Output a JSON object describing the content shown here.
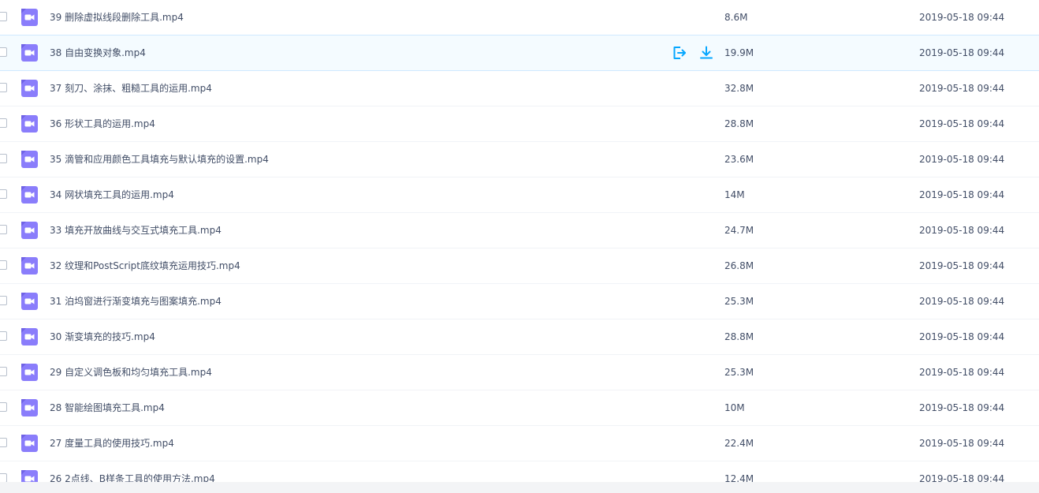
{
  "colors": {
    "video_icon": "#8a7dfb",
    "action_icon": "#06a7ff",
    "text": "#424e67",
    "hover_row": "#f4fbff"
  },
  "row_icon": "video-file-icon",
  "row_actions": [
    "share-icon",
    "download-icon"
  ],
  "files": [
    {
      "name": "39 删除虚拟线段删除工具.mp4",
      "size": "8.6M",
      "date": "2019-05-18 09:44"
    },
    {
      "name": "38 自由变换对象.mp4",
      "size": "19.9M",
      "date": "2019-05-18 09:44",
      "hover": true
    },
    {
      "name": "37 刻刀、涂抹、粗糙工具的运用.mp4",
      "size": "32.8M",
      "date": "2019-05-18 09:44"
    },
    {
      "name": "36 形状工具的运用.mp4",
      "size": "28.8M",
      "date": "2019-05-18 09:44"
    },
    {
      "name": "35 滴管和应用颜色工具填充与默认填充的设置.mp4",
      "size": "23.6M",
      "date": "2019-05-18 09:44"
    },
    {
      "name": "34 网状填充工具的运用.mp4",
      "size": "14M",
      "date": "2019-05-18 09:44"
    },
    {
      "name": "33 填充开放曲线与交互式填充工具.mp4",
      "size": "24.7M",
      "date": "2019-05-18 09:44"
    },
    {
      "name": "32 纹理和PostScript底纹填充运用技巧.mp4",
      "size": "26.8M",
      "date": "2019-05-18 09:44"
    },
    {
      "name": "31 泊坞窗进行渐变填充与图案填充.mp4",
      "size": "25.3M",
      "date": "2019-05-18 09:44"
    },
    {
      "name": "30 渐变填充的技巧.mp4",
      "size": "28.8M",
      "date": "2019-05-18 09:44"
    },
    {
      "name": "29 自定义调色板和均匀填充工具.mp4",
      "size": "25.3M",
      "date": "2019-05-18 09:44"
    },
    {
      "name": "28 智能绘图填充工具.mp4",
      "size": "10M",
      "date": "2019-05-18 09:44"
    },
    {
      "name": "27 度量工具的使用技巧.mp4",
      "size": "22.4M",
      "date": "2019-05-18 09:44"
    },
    {
      "name": "26 2点线、B样条工具的使用方法.mp4",
      "size": "12.4M",
      "date": "2019-05-18 09:44"
    }
  ]
}
